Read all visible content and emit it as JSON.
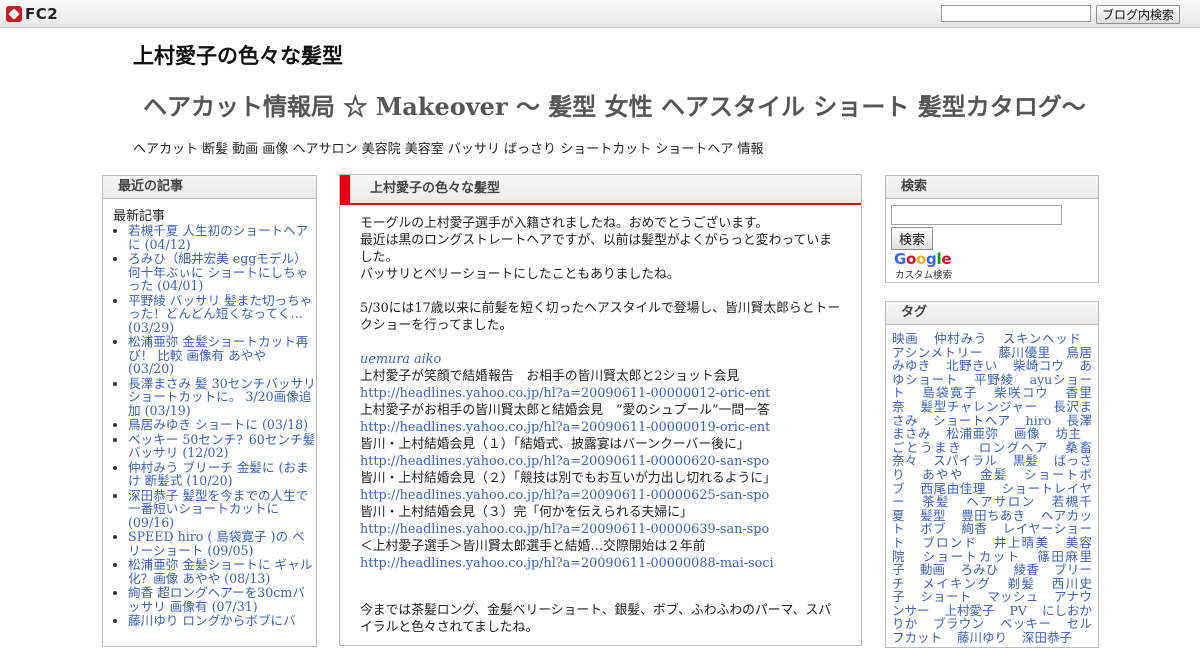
{
  "topbar": {
    "logo_text": "FC2",
    "search_button": "ブログ内検索"
  },
  "header": {
    "title": "上村愛子の色々な髪型",
    "subtitle": "ヘアカット情報局 ☆ Makeover ～ 髪型 女性 ヘアスタイル ショート 髪型カタログ～",
    "keywords": "ヘアカット 断髪 動画 画像 ヘアサロン 美容院 美容室 バッサリ ばっさり ショートカット ショートヘア 情報"
  },
  "recent": {
    "heading": "最近の記事",
    "label": "最新記事",
    "items": [
      "若槻千夏 人生初のショートヘアに (04/12)",
      "ろみひ（細井宏美 eggモデル）何十年ぶぃに ショートにしちゃった (04/01)",
      "平野綾 バッサリ 髪また切っちゃった！どんどん短くなってく… (03/29)",
      "松浦亜弥 金髪ショートカット再び！ 比較 画像有 あやや (03/20)",
      "長澤まさみ 髪 30センチバッサリショートカットに。 3/20画像追加 (03/19)",
      "鳥居みゆき ショートに (03/18)",
      "ベッキー 50センチ？60センチ髪バッサリ (12/02)",
      "仲村みう ブリーチ 金髪に (おまけ 断髪式 (10/20)",
      "深田恭子 髪型を今までの人生で一番短いショートカットに (09/16)",
      "SPEED hiro ( 島袋寛子 )の ベリーショート (09/05)",
      "松浦亜弥 金髪ショートに ギャル化？画像 あやや (08/13)",
      "絢香 超ロングヘアーを30cmバッサリ 画像有 (07/31)",
      "藤川ゆり ロングからボブにバ"
    ]
  },
  "article": {
    "title": "上村愛子の色々な髪型",
    "p1": "モーグルの上村愛子選手が入籍されましたね。おめでとうございます。",
    "p2": "最近は黒のロングストレートヘアですが、以前は髪型がよくがらっと変わっていました。",
    "p3": "バッサリとベリーショートにしたこともありましたね。",
    "p4": "5/30には17歳以来に前髪を短く切ったヘアスタイルで登場し、皆川賢太郎らとトークショーを行ってました。",
    "tag": "uemura aiko",
    "news": [
      {
        "title": "上村愛子が笑顔で結婚報告　お相手の皆川賢太郎と2ショット会見",
        "url": "http://headlines.yahoo.co.jp/hl?a=20090611-00000012-oric-ent"
      },
      {
        "title": "上村愛子がお相手の皆川賢太郎と結婚会見　“愛のシュプール”一問一答",
        "url": "http://headlines.yahoo.co.jp/hl?a=20090611-00000019-oric-ent"
      },
      {
        "title": "皆川・上村結婚会見（１）「結婚式、披露宴はバーンクーバー後に」",
        "url": "http://headlines.yahoo.co.jp/hl?a=20090611-00000620-san-spo"
      },
      {
        "title": "皆川・上村結婚会見（２）「競技は別でもお互いが力出し切れるように」",
        "url": "http://headlines.yahoo.co.jp/hl?a=20090611-00000625-san-spo"
      },
      {
        "title": "皆川・上村結婚会見（３）完「何かを伝えられる夫婦に」",
        "url": "http://headlines.yahoo.co.jp/hl?a=20090611-00000639-san-spo"
      },
      {
        "title": "＜上村愛子選手＞皆川賢太郎選手と結婚…交際開始は２年前",
        "url": "http://headlines.yahoo.co.jp/hl?a=20090611-00000088-mai-soci"
      }
    ],
    "p5": "今までは茶髪ロング、金髪ベリーショート、銀髪、ボブ、ふわふわのパーマ、スパイラルと色々されてましたね。"
  },
  "search_widget": {
    "heading": "検索",
    "button": "検索",
    "powered_text": "カスタム検索"
  },
  "tags_widget": {
    "heading": "タグ",
    "tags": [
      "映画",
      "仲村みう",
      "スキンヘッド",
      "アシンメトリー",
      "藤川優里",
      "鳥居みゆき",
      "北野きい",
      "柴崎コウ",
      "あゆショート",
      "平野綾",
      "ayuショート",
      "島袋寛子",
      "柴咲コウ",
      "香里奈",
      "髪型チャレンジャー",
      "長沢まさみ",
      "ショートヘア",
      "hiro",
      "長澤まさみ",
      "松浦亜弥",
      "画像",
      "坊主",
      "ごとうまき",
      "ロングヘア",
      "桑畜奈々",
      "スパイラル",
      "黒髪",
      "ばっさり",
      "あやや",
      "金髪",
      "ショートボブ",
      "西尾由佳理",
      "ショートレイヤー",
      "茶髪",
      "ヘアサロン",
      "若槻千夏",
      "髪型",
      "豊田ちあき",
      "ヘアカット",
      "ボブ",
      "絢香",
      "レイヤーショート",
      "ブロンド",
      "井上晴美",
      "美容院",
      "ショートカット",
      "篠田麻里子",
      "動画",
      "ろみひ",
      "綾香",
      "ブリーチ",
      "メイキング",
      "剃髪",
      "西川史子",
      "ショート",
      "マッシュ",
      "アナウンサー",
      "上村愛子",
      "PV",
      "にしおかりか",
      "ブラウン",
      "ベッキー",
      "セルフカット",
      "藤川ゆり",
      "深田恭子"
    ]
  }
}
